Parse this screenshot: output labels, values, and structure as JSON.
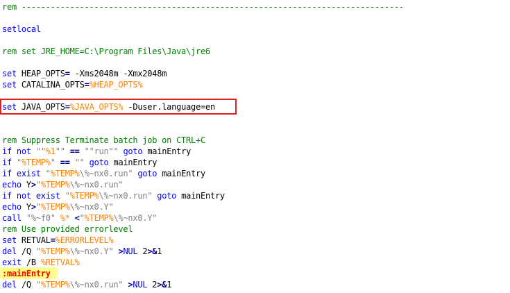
{
  "editor": {
    "colors": {
      "keyword": "#0000ff",
      "comment": "#008000",
      "string": "#808080",
      "variable": "#ff8000",
      "operator": "#000080",
      "label": "#ff0000",
      "label_highlight": "#ffff80",
      "annotation_box": "#e02020"
    },
    "lines": [
      {
        "id": "l1",
        "tokens": [
          {
            "t": "cm",
            "v": "rem -------------------------------------------------------------------------------"
          }
        ]
      },
      {
        "id": "l2",
        "tokens": []
      },
      {
        "id": "l3",
        "tokens": [
          {
            "t": "kw",
            "v": "setlocal"
          }
        ]
      },
      {
        "id": "l4",
        "tokens": []
      },
      {
        "id": "l5",
        "tokens": [
          {
            "t": "cm",
            "v": "rem set JRE_HOME=C:\\Program Files\\Java\\jre6"
          }
        ]
      },
      {
        "id": "l6",
        "tokens": []
      },
      {
        "id": "l7",
        "tokens": [
          {
            "t": "kw",
            "v": "set"
          },
          {
            "t": "txt",
            "v": " HEAP_OPTS"
          },
          {
            "t": "op",
            "v": "="
          },
          {
            "t": "txt",
            "v": " -Xms2048m -Xmx2048m"
          }
        ]
      },
      {
        "id": "l8",
        "tokens": [
          {
            "t": "kw",
            "v": "set"
          },
          {
            "t": "txt",
            "v": " CATALINA_OPTS"
          },
          {
            "t": "op",
            "v": "="
          },
          {
            "t": "var",
            "v": "%HEAP_OPTS%"
          }
        ]
      },
      {
        "id": "l9",
        "tokens": []
      },
      {
        "id": "l10",
        "tokens": [
          {
            "t": "kw",
            "v": "set"
          },
          {
            "t": "txt",
            "v": " JAVA_OPTS"
          },
          {
            "t": "op",
            "v": "="
          },
          {
            "t": "var",
            "v": "%JAVA_OPTS%"
          },
          {
            "t": "txt",
            "v": " -Duser.language=en"
          }
        ]
      },
      {
        "id": "l11",
        "tokens": []
      },
      {
        "id": "l12",
        "tokens": []
      },
      {
        "id": "l13",
        "tokens": [
          {
            "t": "cm",
            "v": "rem Suppress Terminate batch job on CTRL+C"
          }
        ]
      },
      {
        "id": "l14",
        "tokens": [
          {
            "t": "kw",
            "v": "if not"
          },
          {
            "t": "txt",
            "v": " "
          },
          {
            "t": "str",
            "v": "\"\""
          },
          {
            "t": "var",
            "v": "%1"
          },
          {
            "t": "str",
            "v": "\"\""
          },
          {
            "t": "txt",
            "v": " "
          },
          {
            "t": "op",
            "v": "=="
          },
          {
            "t": "txt",
            "v": " "
          },
          {
            "t": "str",
            "v": "\"\"run\"\""
          },
          {
            "t": "txt",
            "v": " "
          },
          {
            "t": "kw",
            "v": "goto"
          },
          {
            "t": "txt",
            "v": " mainEntry"
          }
        ]
      },
      {
        "id": "l15",
        "tokens": [
          {
            "t": "kw",
            "v": "if"
          },
          {
            "t": "txt",
            "v": " "
          },
          {
            "t": "str",
            "v": "\""
          },
          {
            "t": "var",
            "v": "%TEMP%"
          },
          {
            "t": "str",
            "v": "\""
          },
          {
            "t": "txt",
            "v": " "
          },
          {
            "t": "op",
            "v": "=="
          },
          {
            "t": "txt",
            "v": " "
          },
          {
            "t": "str",
            "v": "\"\""
          },
          {
            "t": "txt",
            "v": " "
          },
          {
            "t": "kw",
            "v": "goto"
          },
          {
            "t": "txt",
            "v": " mainEntry"
          }
        ]
      },
      {
        "id": "l16",
        "tokens": [
          {
            "t": "kw",
            "v": "if exist"
          },
          {
            "t": "txt",
            "v": " "
          },
          {
            "t": "str",
            "v": "\""
          },
          {
            "t": "var",
            "v": "%TEMP%"
          },
          {
            "t": "str",
            "v": "\\%~nx0.run\""
          },
          {
            "t": "txt",
            "v": " "
          },
          {
            "t": "kw",
            "v": "goto"
          },
          {
            "t": "txt",
            "v": " mainEntry"
          }
        ]
      },
      {
        "id": "l17",
        "tokens": [
          {
            "t": "kw",
            "v": "echo"
          },
          {
            "t": "txt",
            "v": " Y"
          },
          {
            "t": "op",
            "v": ">"
          },
          {
            "t": "str",
            "v": "\""
          },
          {
            "t": "var",
            "v": "%TEMP%"
          },
          {
            "t": "str",
            "v": "\\%~nx0.run\""
          }
        ]
      },
      {
        "id": "l18",
        "tokens": [
          {
            "t": "kw",
            "v": "if not exist"
          },
          {
            "t": "txt",
            "v": " "
          },
          {
            "t": "str",
            "v": "\""
          },
          {
            "t": "var",
            "v": "%TEMP%"
          },
          {
            "t": "str",
            "v": "\\%~nx0.run\""
          },
          {
            "t": "txt",
            "v": " "
          },
          {
            "t": "kw",
            "v": "goto"
          },
          {
            "t": "txt",
            "v": " mainEntry"
          }
        ]
      },
      {
        "id": "l19",
        "tokens": [
          {
            "t": "kw",
            "v": "echo"
          },
          {
            "t": "txt",
            "v": " Y"
          },
          {
            "t": "op",
            "v": ">"
          },
          {
            "t": "str",
            "v": "\""
          },
          {
            "t": "var",
            "v": "%TEMP%"
          },
          {
            "t": "str",
            "v": "\\%~nx0.Y\""
          }
        ]
      },
      {
        "id": "l20",
        "tokens": [
          {
            "t": "kw",
            "v": "call"
          },
          {
            "t": "txt",
            "v": " "
          },
          {
            "t": "str",
            "v": "\"%~f0\""
          },
          {
            "t": "txt",
            "v": " "
          },
          {
            "t": "var",
            "v": "%*"
          },
          {
            "t": "txt",
            "v": " "
          },
          {
            "t": "op",
            "v": "<"
          },
          {
            "t": "str",
            "v": "\""
          },
          {
            "t": "var",
            "v": "%TEMP%"
          },
          {
            "t": "str",
            "v": "\\%~nx0.Y\""
          }
        ]
      },
      {
        "id": "l21",
        "tokens": [
          {
            "t": "cm",
            "v": "rem Use provided errorlevel"
          }
        ]
      },
      {
        "id": "l22",
        "tokens": [
          {
            "t": "kw",
            "v": "set"
          },
          {
            "t": "txt",
            "v": " RETVAL"
          },
          {
            "t": "op",
            "v": "="
          },
          {
            "t": "var",
            "v": "%ERRORLEVEL%"
          }
        ]
      },
      {
        "id": "l23",
        "tokens": [
          {
            "t": "kw",
            "v": "del"
          },
          {
            "t": "txt",
            "v": " /Q "
          },
          {
            "t": "str",
            "v": "\""
          },
          {
            "t": "var",
            "v": "%TEMP%"
          },
          {
            "t": "str",
            "v": "\\%~nx0.Y\""
          },
          {
            "t": "txt",
            "v": " "
          },
          {
            "t": "op",
            "v": ">"
          },
          {
            "t": "kw",
            "v": "NUL"
          },
          {
            "t": "txt",
            "v": " 2"
          },
          {
            "t": "op",
            "v": ">&"
          },
          {
            "t": "txt",
            "v": "1"
          }
        ]
      },
      {
        "id": "l24",
        "tokens": [
          {
            "t": "kw",
            "v": "exit"
          },
          {
            "t": "txt",
            "v": " /B "
          },
          {
            "t": "var",
            "v": "%RETVAL%"
          }
        ]
      },
      {
        "id": "l25",
        "tokens": [
          {
            "t": "lbl",
            "v": ":mainEntry"
          }
        ]
      },
      {
        "id": "l26",
        "tokens": [
          {
            "t": "kw",
            "v": "del"
          },
          {
            "t": "txt",
            "v": " /Q "
          },
          {
            "t": "str",
            "v": "\""
          },
          {
            "t": "var",
            "v": "%TEMP%"
          },
          {
            "t": "str",
            "v": "\\%~nx0.run\""
          },
          {
            "t": "txt",
            "v": " "
          },
          {
            "t": "op",
            "v": ">"
          },
          {
            "t": "kw",
            "v": "NUL"
          },
          {
            "t": "txt",
            "v": " 2"
          },
          {
            "t": "op",
            "v": ">&"
          },
          {
            "t": "txt",
            "v": "1"
          }
        ]
      }
    ]
  }
}
